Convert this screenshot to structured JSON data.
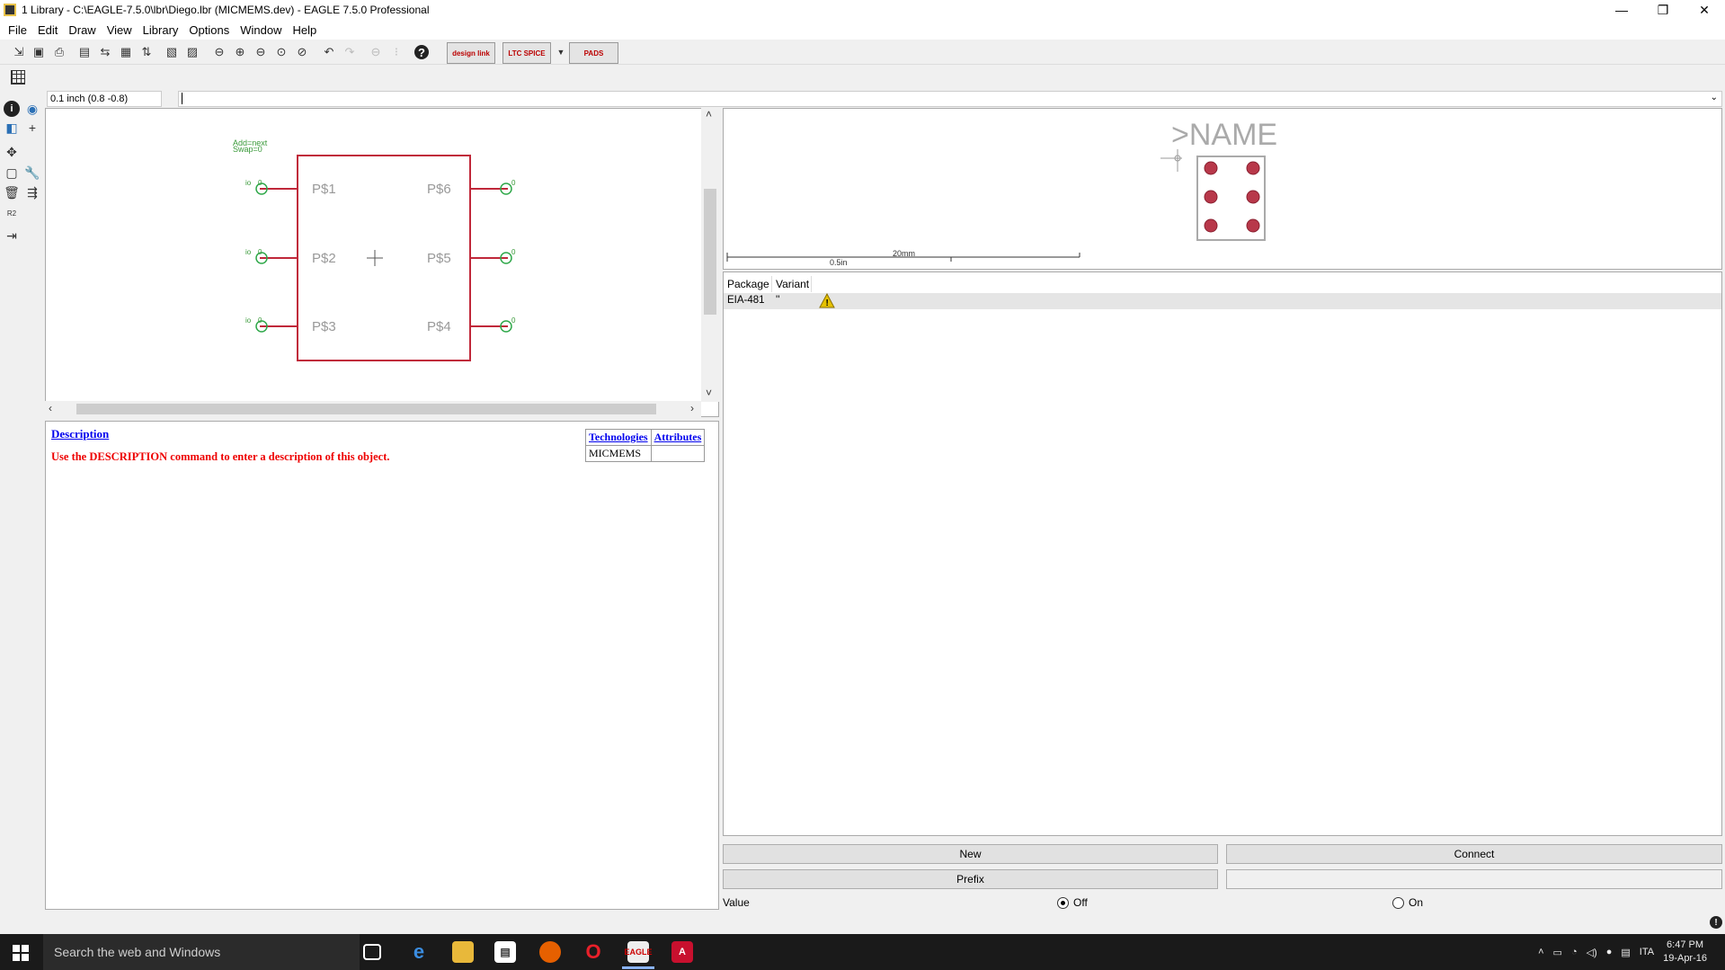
{
  "window": {
    "title": "1 Library - C:\\EAGLE-7.5.0\\lbr\\Diego.lbr (MICMEMS.dev) - EAGLE 7.5.0 Professional",
    "minimize": "—",
    "maximize": "❐",
    "close": "✕"
  },
  "menubar": [
    "File",
    "Edit",
    "Draw",
    "View",
    "Library",
    "Options",
    "Window",
    "Help"
  ],
  "toolbar": {
    "design_link": "design link",
    "ltc_spice": "LTC SPICE",
    "pads": "PADS"
  },
  "coord": {
    "value": "0.1 inch (0.8 -0.8)"
  },
  "symbol": {
    "add_label": "Add=next",
    "swap_label": "Swap=0",
    "pins_left": [
      "P$1",
      "P$2",
      "P$3"
    ],
    "pins_right": [
      "P$6",
      "P$5",
      "P$4"
    ],
    "pin_dir": "io",
    "pin_swap": "0"
  },
  "description": {
    "link": "Description",
    "text": "Use the DESCRIPTION command to enter a description of this object.",
    "technologies_header": "Technologies",
    "attributes_header": "Attributes",
    "technology": "MICMEMS",
    "attribute": ""
  },
  "package_preview": {
    "name_label": ">NAME",
    "scale_mm": "20mm",
    "scale_in": "0.5in"
  },
  "package_list": {
    "headers": [
      "Package",
      "Variant"
    ],
    "rows": [
      {
        "package": "EIA-481",
        "variant": "''"
      }
    ]
  },
  "buttons": {
    "new": "New",
    "connect": "Connect",
    "prefix": "Prefix"
  },
  "value": {
    "label": "Value",
    "off": "Off",
    "on": "On",
    "selected": "Off"
  },
  "taskbar": {
    "search": "Search the web and Windows",
    "lang": "ITA",
    "time": "6:47 PM",
    "date": "19-Apr-16"
  }
}
